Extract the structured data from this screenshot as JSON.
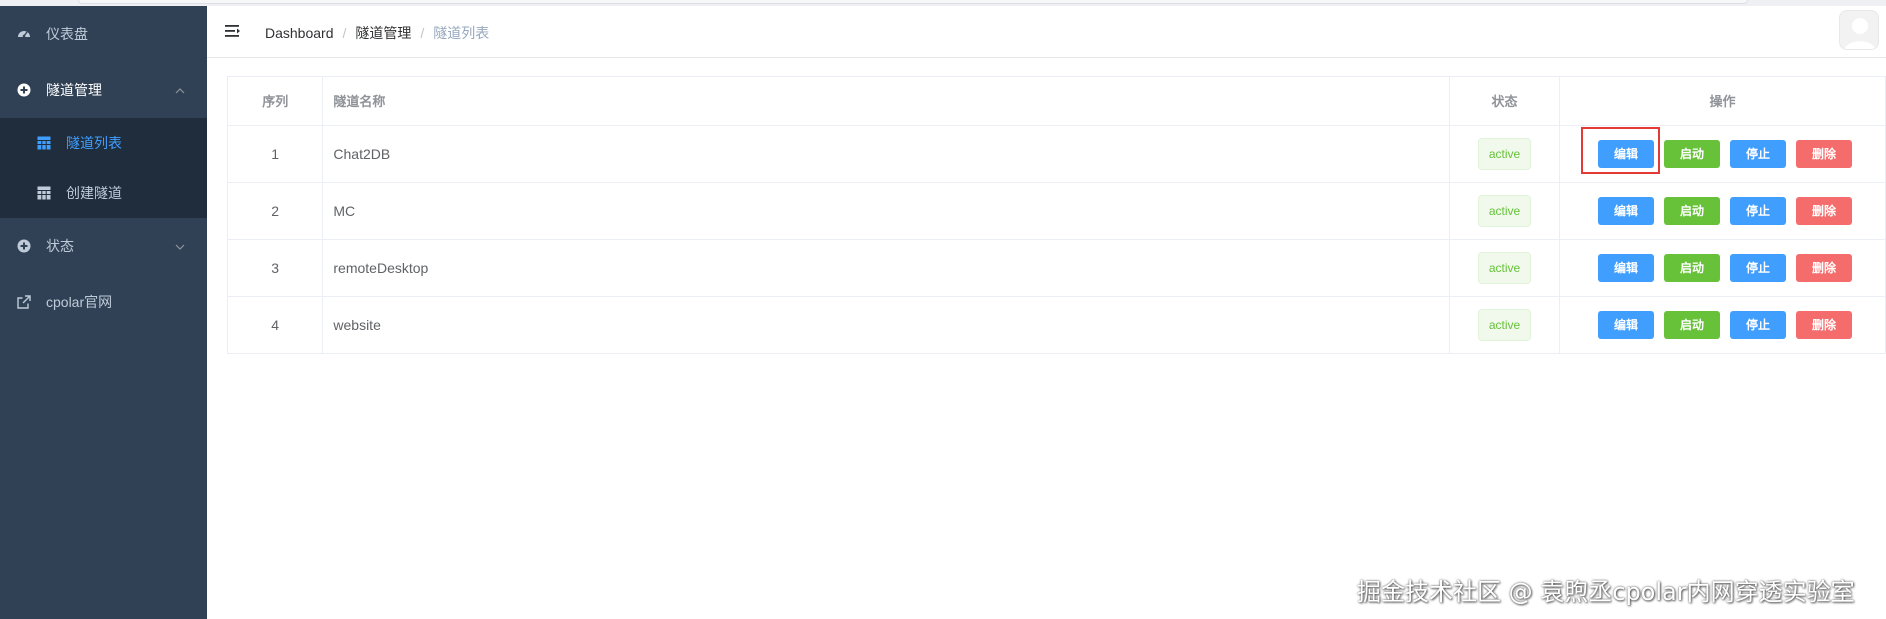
{
  "sidebar": {
    "items": [
      {
        "label": "仪表盘",
        "icon": "dashboard-icon"
      },
      {
        "label": "隧道管理",
        "icon": "plus-circle-icon",
        "expanded": true,
        "children": [
          {
            "label": "隧道列表",
            "icon": "table-icon",
            "active": true
          },
          {
            "label": "创建隧道",
            "icon": "table-icon"
          }
        ]
      },
      {
        "label": "状态",
        "icon": "plus-circle-icon",
        "expanded": false
      },
      {
        "label": "cpolar官网",
        "icon": "external-link-icon"
      }
    ]
  },
  "header": {
    "breadcrumb": [
      "Dashboard",
      "隧道管理",
      "隧道列表"
    ],
    "separator": "/"
  },
  "table": {
    "columns": [
      "序列",
      "隧道名称",
      "状态",
      "操作"
    ],
    "rows": [
      {
        "index": "1",
        "name": "Chat2DB",
        "status": "active"
      },
      {
        "index": "2",
        "name": "MC",
        "status": "active"
      },
      {
        "index": "3",
        "name": "remoteDesktop",
        "status": "active"
      },
      {
        "index": "4",
        "name": "website",
        "status": "active"
      }
    ],
    "actions": {
      "edit": "编辑",
      "start": "启动",
      "stop": "停止",
      "delete": "删除"
    }
  },
  "watermark": "掘金技术社区 @ 袁煦丞cpolar内网穿透实验室",
  "colors": {
    "sidebar_bg": "#304156",
    "submenu_bg": "#1f2d3d",
    "active": "#409eff",
    "success": "#67c23a",
    "danger": "#f56c6c",
    "highlight": "#e53935"
  }
}
